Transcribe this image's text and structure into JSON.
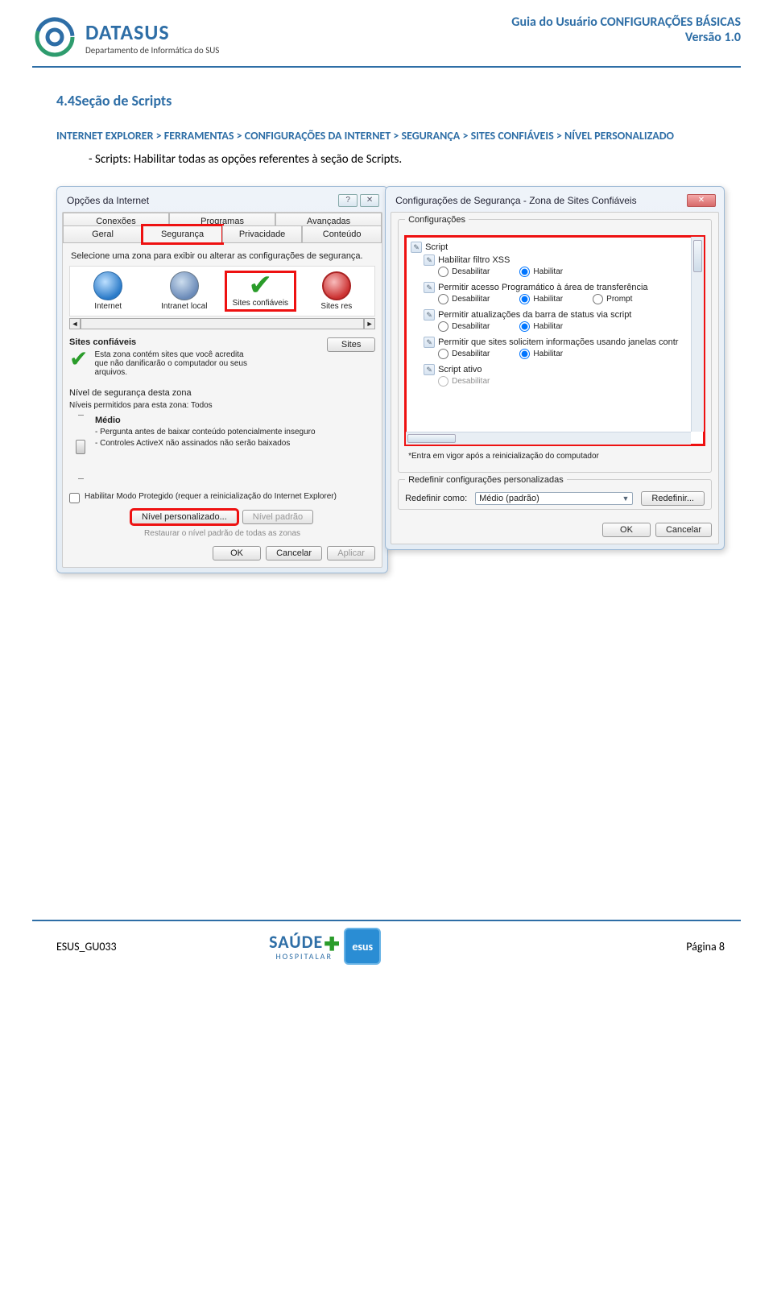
{
  "header": {
    "logo_title": "DATASUS",
    "logo_subtitle": "Departamento de Informática do SUS",
    "doc_title": "Guia do Usuário CONFIGURAÇÕES BÁSICAS",
    "doc_version": "Versão 1.0"
  },
  "section": {
    "number_title": "4.4Seção de Scripts",
    "path_full": "INTERNET EXPLORER > FERRAMENTAS > CONFIGURAÇÕES DA INTERNET > SEGURANÇA > SITES CONFIÁVEIS > NÍVEL PERSONALIZADO",
    "bullet": "- Scripts: Habilitar todas as opções referentes à seção de Scripts."
  },
  "dlg_left": {
    "title": "Opções da Internet",
    "tabs_row1": [
      "Conexões",
      "Programas",
      "Avançadas"
    ],
    "tabs_row2": [
      "Geral",
      "Segurança",
      "Privacidade",
      "Conteúdo"
    ],
    "zone_prompt": "Selecione uma zona para exibir ou alterar as configurações de segurança.",
    "zones": [
      "Internet",
      "Intranet local",
      "Sites confiáveis",
      "Sites res"
    ],
    "trusted_title": "Sites confiáveis",
    "trusted_desc": "Esta zona contém sites que você acredita que não danificarão o computador ou seus arquivos.",
    "sites_btn": "Sites",
    "level_title": "Nível de segurança desta zona",
    "level_allowed": "Níveis permitidos para esta zona: Todos",
    "level_name": "Médio",
    "level_line1": "- Pergunta antes de baixar conteúdo potencialmente inseguro",
    "level_line2": "- Controles ActiveX não assinados não serão baixados",
    "protected_mode": "Habilitar Modo Protegido (requer a reinicialização do Internet Explorer)",
    "btn_custom": "Nível personalizado...",
    "btn_default": "Nível padrão",
    "btn_restore": "Restaurar o nível padrão de todas as zonas",
    "btn_ok": "OK",
    "btn_cancel": "Cancelar",
    "btn_apply": "Aplicar"
  },
  "dlg_right": {
    "title": "Configurações de Segurança - Zona de Sites Confiáveis",
    "group": "Configurações",
    "tree": {
      "root": "Script",
      "g1": {
        "title": "Habilitar filtro XSS",
        "opts": [
          "Desabilitar",
          "Habilitar"
        ],
        "sel": 1
      },
      "g2": {
        "title": "Permitir acesso Programático à área de transferência",
        "opts": [
          "Desabilitar",
          "Habilitar",
          "Prompt"
        ],
        "sel": 1
      },
      "g3": {
        "title": "Permitir atualizações da barra de status via script",
        "opts": [
          "Desabilitar",
          "Habilitar"
        ],
        "sel": 1
      },
      "g4": {
        "title": "Permitir que sites solicitem informações usando janelas contr",
        "opts": [
          "Desabilitar",
          "Habilitar"
        ],
        "sel": 1
      },
      "g5": {
        "title": "Script ativo",
        "opt_cut": "Desabilitar"
      }
    },
    "note": "*Entra em vigor após a reinicialização do computador",
    "reset_group": "Redefinir configurações personalizadas",
    "reset_label": "Redefinir como:",
    "reset_value": "Médio (padrão)",
    "btn_reset": "Redefinir...",
    "btn_ok": "OK",
    "btn_cancel": "Cancelar"
  },
  "footer": {
    "doc_code": "ESUS_GU033",
    "page": "Página 8",
    "logo1": "SAÚDE",
    "logo1_sub": "HOSPITALAR",
    "logo2": "esus"
  }
}
